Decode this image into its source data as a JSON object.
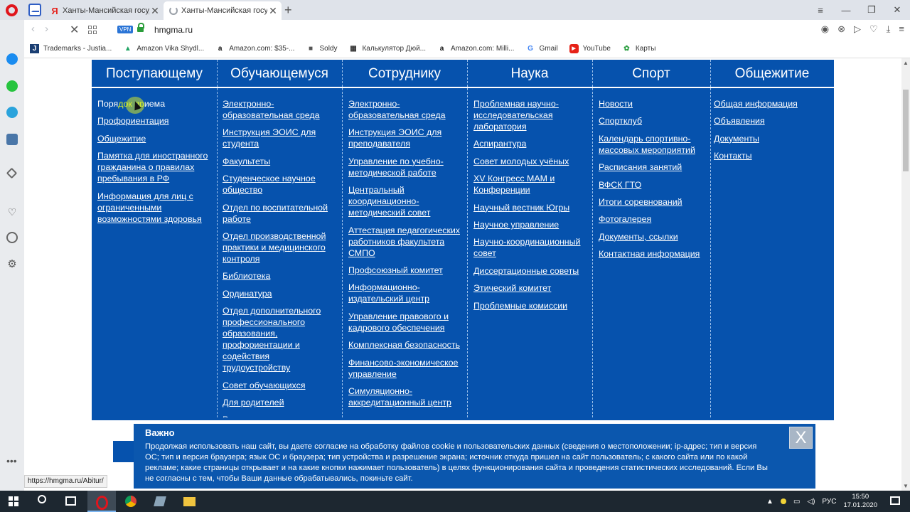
{
  "browser": {
    "tabs": [
      {
        "title": "Ханты-Мансийская госуда"
      },
      {
        "title": "Ханты-Мансийская госуда"
      }
    ],
    "vpn_label": "VPN",
    "url": "hmgma.ru",
    "status_url": "https://hmgma.ru/Abitur/"
  },
  "bookmarks": [
    {
      "icon": "J",
      "label": "Trademarks - Justia..."
    },
    {
      "icon": "▲",
      "label": "Amazon Vika Shydl..."
    },
    {
      "icon": "a",
      "label": "Amazon.com: $35-..."
    },
    {
      "icon": "■",
      "label": "Soldy"
    },
    {
      "icon": "▦",
      "label": "Калькулятор Дюй..."
    },
    {
      "icon": "a",
      "label": "Amazon.com: Milli..."
    },
    {
      "icon": "G",
      "label": "Gmail"
    },
    {
      "icon": "▶",
      "label": "YouTube"
    },
    {
      "icon": "✿",
      "label": "Карты"
    }
  ],
  "menu": {
    "headers": [
      "Поступающему",
      "Обучающемуся",
      "Сотруднику",
      "Наука",
      "Спорт",
      "Общежитие"
    ],
    "col1": {
      "first_pre": "Поря",
      "first_hl": "док пр",
      "first_post": "иема",
      "links": [
        "Профориентация",
        "Общежитие",
        "Памятка для иностранного гражданина о правилах пребывания в РФ",
        "Информация для лиц с ограниченными возможностями здоровья"
      ]
    },
    "col2": [
      "Электронно-образовательная среда",
      "Инструкция ЭОИС для студента",
      "Факультеты",
      "Студенческое научное общество",
      "Отдел по воспитательной работе",
      "Отдел производственной практики и медицинского контроля",
      "Библиотека",
      "Ординатура",
      "Отдел дополнительного профессионального образования, профориентации и содействия трудоустройству",
      "Совет обучающихся",
      "Для родителей",
      "Реквизиты для оплаты"
    ],
    "col3": [
      "Электронно-образовательная среда",
      "Инструкция ЭОИС для преподавателя",
      "Управление по учебно-методической работе",
      "Центральный координационно-методический совет",
      "Аттестация педагогических работников факультета СМПО",
      "Профсоюзный комитет",
      "Информационно-издательский центр",
      "Управление правового и кадрового обеспечения",
      "Комплексная безопасность",
      "Финансово-экономическое управление",
      "Симуляционно-аккредитационный центр"
    ],
    "col4": [
      "Проблемная научно-исследовательская лаборатория",
      "Аспирантура",
      "Совет молодых учёных",
      "XV Конгресс МАМ и Конференции",
      "Научный вестник Югры",
      "Научное управление",
      "Научно-координационный совет",
      "Диссертационные советы",
      "Этический комитет",
      "Проблемные комиссии"
    ],
    "col5": [
      "Новости",
      "Спортклуб",
      "Календарь спортивно-массовых мероприятий",
      "Расписания занятий",
      "ВФСК ГТО",
      "Итоги соревнований",
      "Фотогалерея",
      "Документы, ссылки",
      "Контактная информация"
    ],
    "col6": [
      "Общая информация",
      "Объявления",
      "Документы",
      "Контакты"
    ]
  },
  "cookie": {
    "title": "Важно",
    "text": "Продолжая использовать наш сайт, вы даете согласие на обработку файлов cookie и пользовательских данных (сведения о местоположении; ip-адрес; тип и версия ОС; тип и версия браузера; язык ОС и браузера; тип устройства и разрешение экрана; источник откуда пришел на сайт пользователь; с какого сайта или по какой рекламе; какие страницы открывает и на какие кнопки нажимает пользователь) в целях функционирования сайта и проведения статистических исследований. Если Вы не согласны с тем, чтобы Ваши данные обрабатывались, покиньте сайт.",
    "close_label": "X"
  },
  "taskbar": {
    "language": "РУС",
    "time": "15:50",
    "date": "17.01.2020"
  },
  "colors": {
    "menu_bg": "#0652ad",
    "cookie_bg": "#0b57ae",
    "taskbar_bg": "#1d2730"
  }
}
